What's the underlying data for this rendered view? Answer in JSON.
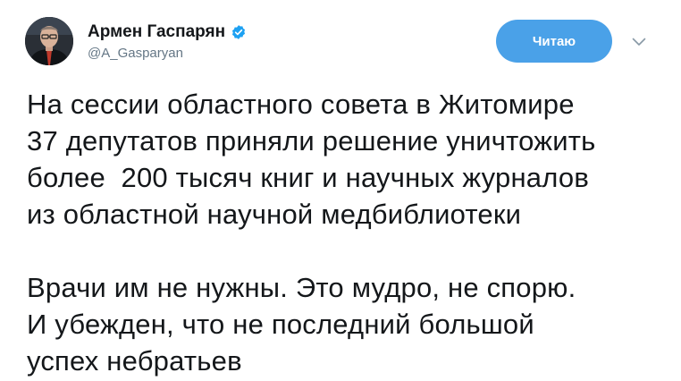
{
  "author": {
    "display_name": "Армен Гаспарян",
    "handle": "@A_Gasparyan",
    "verified": true,
    "avatar_icon": "avatar-photo"
  },
  "actions": {
    "follow_label": "Читаю",
    "more_icon": "chevron-down-icon"
  },
  "tweet": {
    "paragraph1": [
      "На сессии областного совета в Житомире",
      "37 депутатов приняли решение уничтожить",
      "более  200 тысяч книг и научных журналов",
      "из областной научной медбиблиотеки"
    ],
    "paragraph2": [
      "Врачи им не нужны. Это мудро, не спорю.",
      "И убежден, что не последний большой",
      "успех небратьев"
    ]
  },
  "colors": {
    "accent": "#4aa1e8",
    "text": "#14171a",
    "secondary_text": "#657786",
    "verified": "#1da1f2"
  }
}
